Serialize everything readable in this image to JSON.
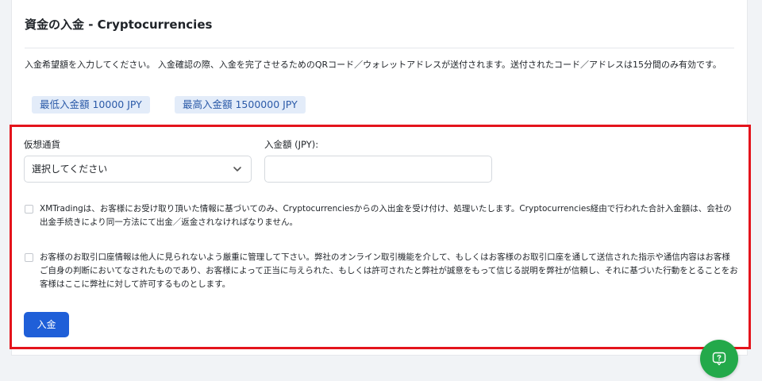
{
  "page": {
    "title": "資金の入金 - Cryptocurrencies",
    "instructions": "入金希望額を入力してください。 入金確認の際、入金を完了させるためのQRコード／ウォレットアドレスが送付されます。送付されたコード／アドレスは15分間のみ有効です。"
  },
  "limits": {
    "min_label": "最低入金額 10000 JPY",
    "max_label": "最高入金額 1500000 JPY"
  },
  "form": {
    "currency_label": "仮想通貨",
    "currency_selected": "選択してください",
    "amount_label": "入金額 (JPY):",
    "amount_value": "",
    "agreement_1": "XMTradingは、お客様にお受け取り頂いた情報に基づいてのみ、Cryptocurrenciesからの入出金を受け付け、処理いたします。Cryptocurrencies経由で行われた合計入金額は、会社の出金手続きにより同一方法にて出金／返金されなければなりません。",
    "agreement_2": "お客様のお取引口座情報は他人に見られないよう厳重に管理して下さい。弊社のオンライン取引機能を介して、もしくはお客様のお取引口座を通して送信された指示や通信内容はお客様ご自身の判断においてなされたものであり、お客様によって正当に与えられた、もしくは許可されたと弊社が誠意をもって信じる説明を弊社が信頼し、それに基づいた行動をとることをお客様はここに弊社に対して許可するものとします。",
    "submit_label": "入金"
  },
  "colors": {
    "highlight_border": "#e4141c",
    "primary_button": "#1f5fd8",
    "badge_bg": "#e3ecf9",
    "help_button": "#23a94a"
  },
  "icons": {
    "select_arrow": "chevron-down-icon",
    "help": "question-bubble-icon"
  }
}
